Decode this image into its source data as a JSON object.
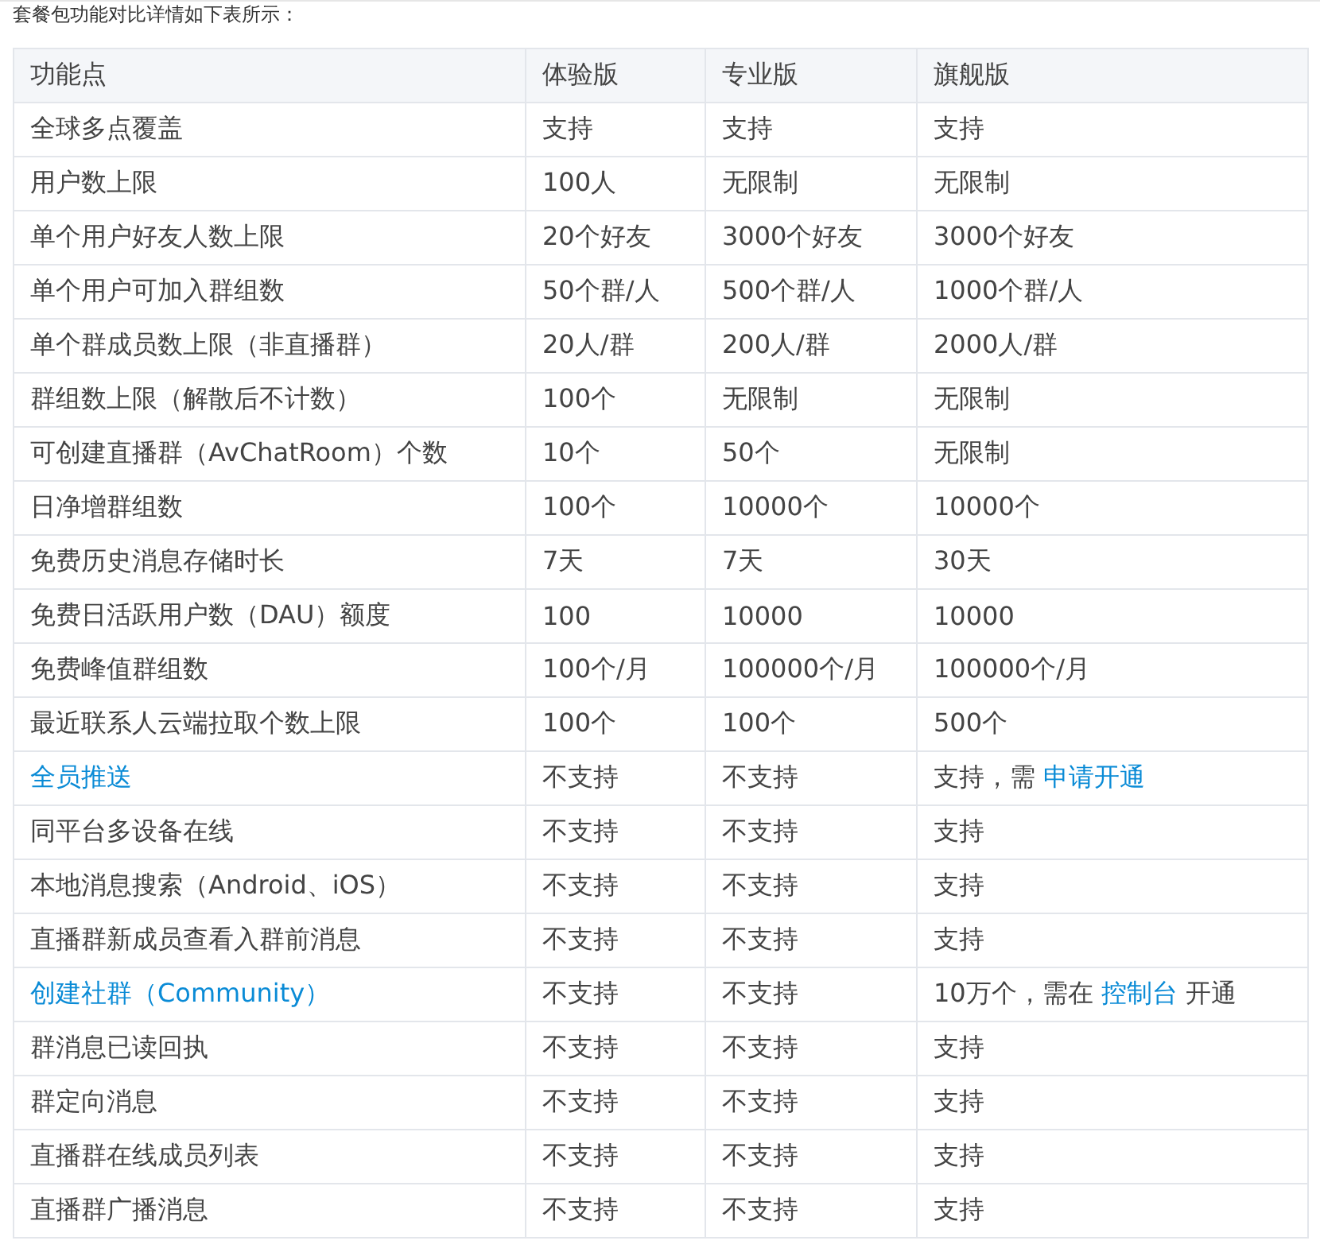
{
  "intro": "套餐包功能对比详情如下表所示：",
  "table": {
    "columns": [
      "功能点",
      "体验版",
      "专业版",
      "旗舰版"
    ],
    "rows": [
      {
        "cells": [
          "全球多点覆盖",
          "支持",
          "支持",
          "支持"
        ]
      },
      {
        "cells": [
          "用户数上限",
          "100人",
          "无限制",
          "无限制"
        ]
      },
      {
        "cells": [
          "单个用户好友人数上限",
          "20个好友",
          "3000个好友",
          "3000个好友"
        ]
      },
      {
        "cells": [
          "单个用户可加入群组数",
          "50个群/人",
          "500个群/人",
          "1000个群/人"
        ]
      },
      {
        "cells": [
          "单个群成员数上限（非直播群）",
          "20人/群",
          "200人/群",
          "2000人/群"
        ]
      },
      {
        "cells": [
          "群组数上限（解散后不计数）",
          "100个",
          "无限制",
          "无限制"
        ]
      },
      {
        "cells": [
          "可创建直播群（AvChatRoom）个数",
          "10个",
          "50个",
          "无限制"
        ]
      },
      {
        "cells": [
          "日净增群组数",
          "100个",
          "10000个",
          "10000个"
        ]
      },
      {
        "cells": [
          "免费历史消息存储时长",
          "7天",
          "7天",
          "30天"
        ]
      },
      {
        "cells": [
          "免费日活跃用户数（DAU）额度",
          "100",
          "10000",
          "10000"
        ]
      },
      {
        "cells": [
          "免费峰值群组数",
          "100个/月",
          "100000个/月",
          "100000个/月"
        ]
      },
      {
        "cells": [
          "最近联系人云端拉取个数上限",
          "100个",
          "100个",
          "500个"
        ]
      },
      {
        "cells": [
          {
            "parts": [
              {
                "kind": "link",
                "text": "全员推送"
              }
            ]
          },
          "不支持",
          "不支持",
          {
            "parts": [
              {
                "kind": "text",
                "text": "支持，需"
              },
              {
                "kind": "link",
                "text": "申请开通"
              }
            ]
          }
        ]
      },
      {
        "cells": [
          "同平台多设备在线",
          "不支持",
          "不支持",
          "支持"
        ]
      },
      {
        "cells": [
          "本地消息搜索（Android、iOS）",
          "不支持",
          "不支持",
          "支持"
        ]
      },
      {
        "cells": [
          "直播群新成员查看入群前消息",
          "不支持",
          "不支持",
          "支持"
        ]
      },
      {
        "cells": [
          {
            "parts": [
              {
                "kind": "link",
                "text": "创建社群（Community）"
              }
            ]
          },
          "不支持",
          "不支持",
          {
            "parts": [
              {
                "kind": "text",
                "text": "10万个，需在"
              },
              {
                "kind": "link",
                "text": "控制台"
              },
              {
                "kind": "text",
                "text": "开通"
              }
            ]
          }
        ]
      },
      {
        "cells": [
          "群消息已读回执",
          "不支持",
          "不支持",
          "支持"
        ]
      },
      {
        "cells": [
          "群定向消息",
          "不支持",
          "不支持",
          "支持"
        ]
      },
      {
        "cells": [
          "直播群在线成员列表",
          "不支持",
          "不支持",
          "支持"
        ]
      },
      {
        "cells": [
          "直播群广播消息",
          "不支持",
          "不支持",
          "支持"
        ]
      }
    ]
  }
}
